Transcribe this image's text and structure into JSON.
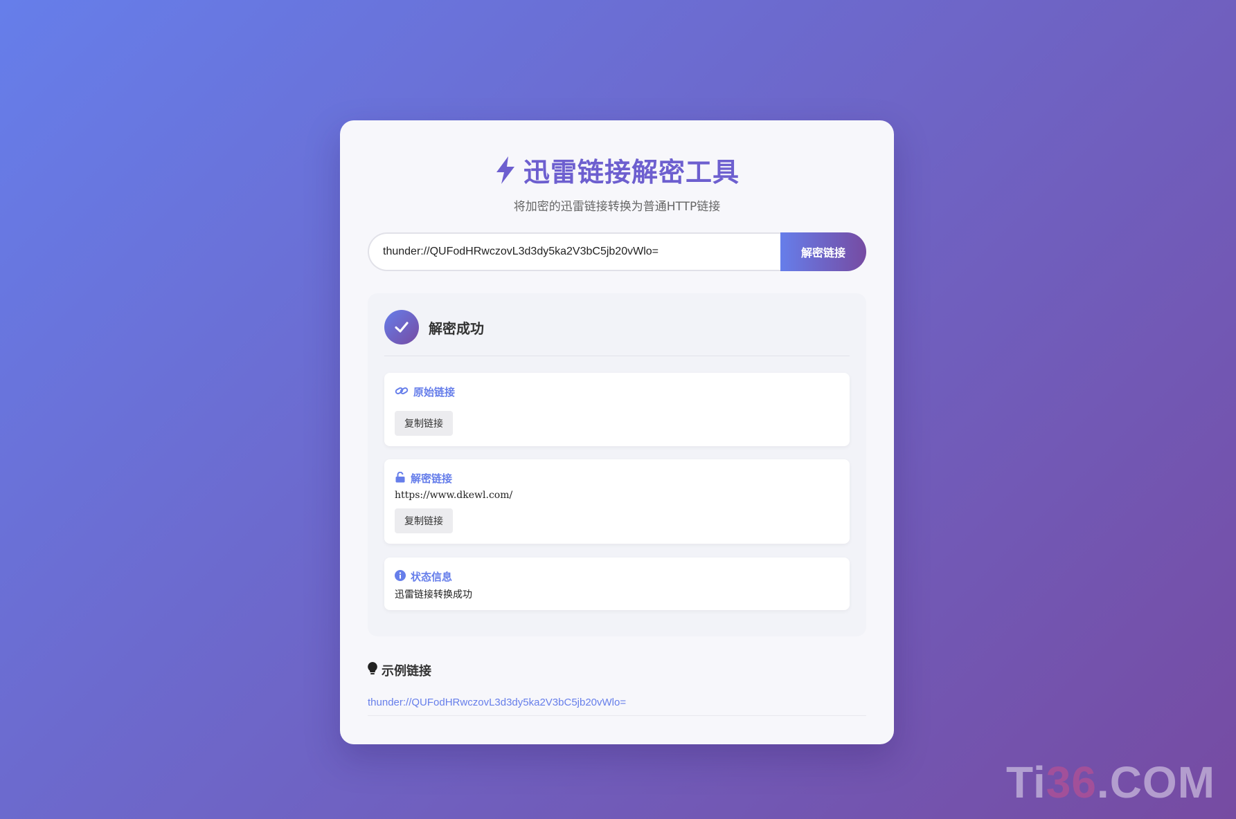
{
  "app": {
    "title": "迅雷链接解密工具",
    "subtitle": "将加密的迅雷链接转换为普通HTTP链接"
  },
  "input": {
    "value": "thunder://QUFodHRwczovL3d3dy5ka2V3bC5jb20vWlo=",
    "placeholder": ""
  },
  "buttons": {
    "decrypt_label": "解密链接",
    "copy_label": "复制链接"
  },
  "result": {
    "title": "解密成功",
    "original": {
      "label": "原始链接",
      "value": ""
    },
    "decrypted": {
      "label": "解密链接",
      "value": "https://www.dkewl.com/"
    },
    "status": {
      "label": "状态信息",
      "value": "迅雷链接转换成功"
    }
  },
  "examples": {
    "title": "示例链接",
    "items": [
      "thunder://QUFodHRwczovL3d3dy5ka2V3bC5jb20vWlo="
    ]
  },
  "watermark": {
    "prefix": "Ti",
    "number": "36",
    "suffix": ".COM"
  },
  "colors": {
    "accent": "#667eea",
    "accent_end": "#764ba2"
  },
  "icons": {
    "title": "bolt-icon",
    "success": "check-icon",
    "original": "link-icon",
    "decrypted": "unlock-icon",
    "status": "info-icon",
    "examples": "lightbulb-icon"
  }
}
